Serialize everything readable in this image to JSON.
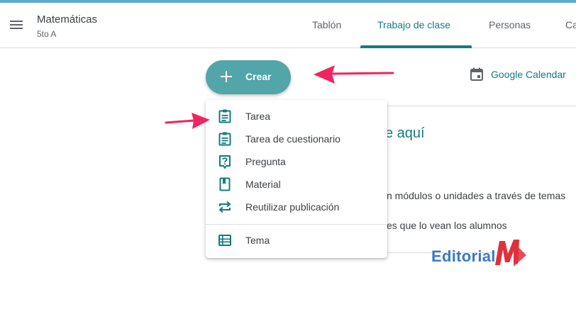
{
  "header": {
    "class_name": "Matemáticas",
    "section": "5to A",
    "tabs": [
      {
        "label": "Tablón"
      },
      {
        "label": "Trabajo de clase"
      },
      {
        "label": "Personas"
      },
      {
        "label": "Ca"
      }
    ],
    "active_tab": "Trabajo de clase"
  },
  "toolbar": {
    "create_label": "Crear",
    "calendar_label": "Google Calendar"
  },
  "create_menu": {
    "items": [
      {
        "label": "Tarea",
        "icon": "assignment-icon"
      },
      {
        "label": "Tarea de cuestionario",
        "icon": "quiz-assignment-icon"
      },
      {
        "label": "Pregunta",
        "icon": "question-icon"
      },
      {
        "label": "Material",
        "icon": "material-book-icon"
      },
      {
        "label": "Reutilizar publicación",
        "icon": "reuse-post-icon"
      },
      {
        "label": "Tema",
        "icon": "topic-list-icon"
      }
    ]
  },
  "content": {
    "heading_fragment": "e aquí",
    "line1_fragment": "n módulos o unidades a través de temas",
    "line2_fragment": "es que lo vean los alumnos"
  },
  "watermark": {
    "text": "Editorial",
    "mark_text": "MD"
  },
  "colors": {
    "accent": "#137b80",
    "create_button": "#52a5a8",
    "annotation_arrow": "#f0245f",
    "logo_blue": "#3b79c4",
    "logo_red": "#e0303a"
  }
}
